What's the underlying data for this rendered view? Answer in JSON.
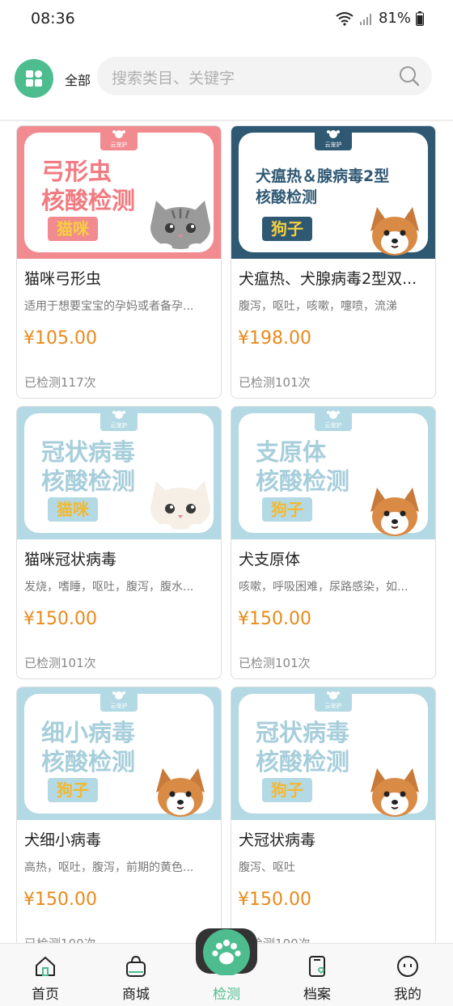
{
  "status_bar": {
    "time": "08:36",
    "battery": "81%"
  },
  "header": {
    "category_label": "全部",
    "search_placeholder": "搜索类目、关键字"
  },
  "colors": {
    "accent": "#4dbd8f",
    "price": "#e88a1c",
    "pink": "#f28b8f",
    "navy": "#2f5873",
    "lightblue": "#b3d9e4"
  },
  "banner_logo_text": "云宠护",
  "cards": [
    {
      "title": "猫咪弓形虫",
      "desc": "适用于想要宝宝的孕妈或者备孕...",
      "price": "¥105.00",
      "count": "已检测117次",
      "banner": {
        "line1": "弓形虫",
        "line2": "核酸检测",
        "tag": "猫咪",
        "theme": "pink",
        "pet": "cat-tabby"
      }
    },
    {
      "title": "犬瘟热、犬腺病毒2型双...",
      "desc": "腹泻，呕吐，咳嗽，嚏喷，流涕",
      "price": "¥198.00",
      "count": "已检测101次",
      "banner": {
        "line1": "犬瘟热＆腺病毒2型",
        "line2": "核酸检测",
        "tag": "狗子",
        "theme": "navy",
        "pet": "dog"
      }
    },
    {
      "title": "猫咪冠状病毒",
      "desc": "发烧，嗜睡，呕吐，腹泻，腹水...",
      "price": "¥150.00",
      "count": "已检测101次",
      "banner": {
        "line1": "冠状病毒",
        "line2": "核酸检测",
        "tag": "猫咪",
        "theme": "lightblue",
        "pet": "cat-white"
      }
    },
    {
      "title": "犬支原体",
      "desc": "咳嗽，呼吸困难，尿路感染，如...",
      "price": "¥150.00",
      "count": "已检测101次",
      "banner": {
        "line1": "支原体",
        "line2": "核酸检测",
        "tag": "狗子",
        "theme": "lightblue",
        "pet": "dog"
      }
    },
    {
      "title": "犬细小病毒",
      "desc": "高热，呕吐，腹泻，前期的黄色...",
      "price": "¥150.00",
      "count": "已检测100次",
      "banner": {
        "line1": "细小病毒",
        "line2": "核酸检测",
        "tag": "狗子",
        "theme": "lightblue",
        "pet": "dog"
      }
    },
    {
      "title": "犬冠状病毒",
      "desc": "腹泻、呕吐",
      "price": "¥150.00",
      "count": "已检测100次",
      "banner": {
        "line1": "冠状病毒",
        "line2": "核酸检测",
        "tag": "狗子",
        "theme": "lightblue",
        "pet": "dog"
      }
    }
  ],
  "bottom_nav": [
    {
      "label": "首页",
      "icon": "home-icon"
    },
    {
      "label": "商城",
      "icon": "shopping-bag-icon"
    },
    {
      "label": "检测",
      "icon": "paw-scan-icon",
      "active": true
    },
    {
      "label": "档案",
      "icon": "record-icon"
    },
    {
      "label": "我的",
      "icon": "profile-icon"
    }
  ]
}
